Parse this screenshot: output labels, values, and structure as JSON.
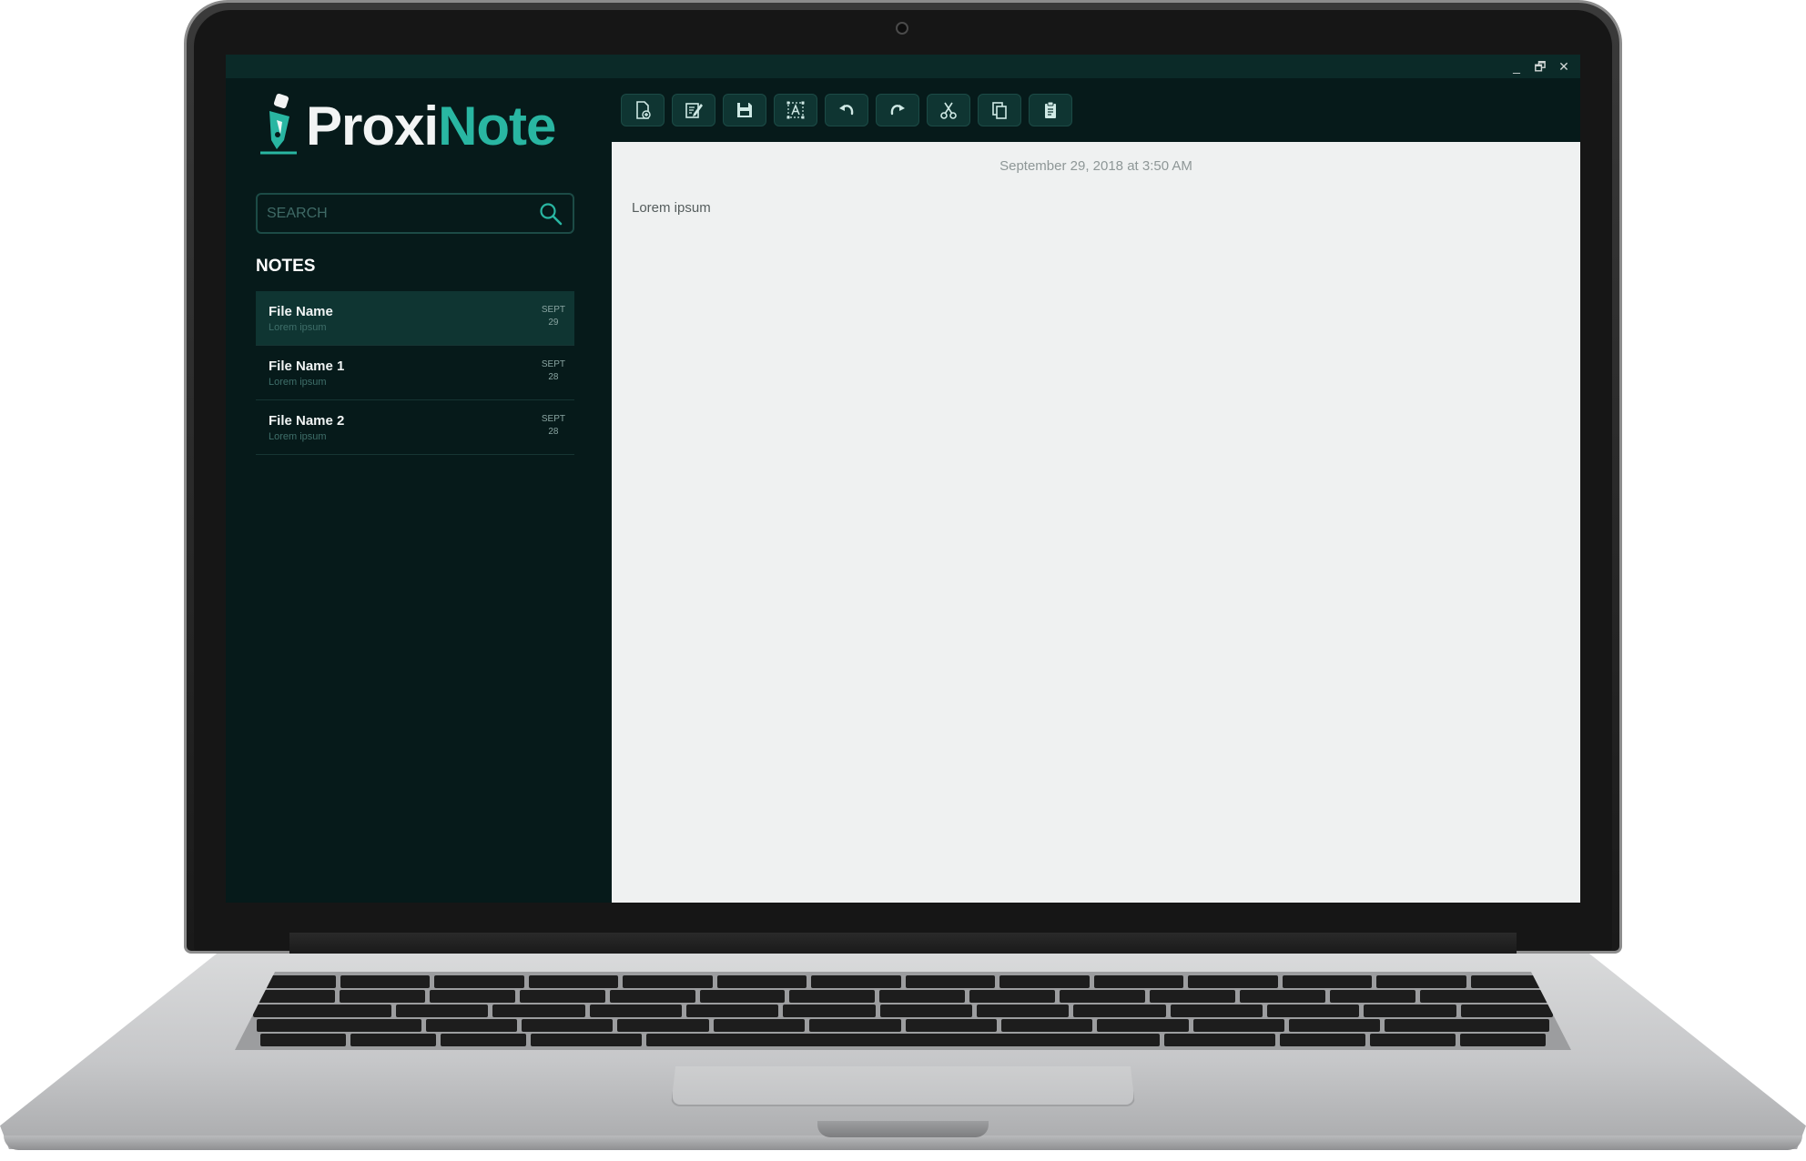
{
  "window": {
    "minimize_glyph": "_",
    "restore_glyph": "🗗",
    "close_glyph": "✕"
  },
  "app": {
    "name_part1": "Proxi",
    "name_part2": "Note"
  },
  "colors": {
    "accent": "#29b6a2",
    "sidebar_bg": "#061a1a",
    "selected_note_bg": "#0f3532",
    "editor_bg": "#eff1f1"
  },
  "search": {
    "placeholder": "SEARCH",
    "value": ""
  },
  "notes": {
    "heading": "NOTES",
    "items": [
      {
        "name": "File Name",
        "preview": "Lorem ipsum",
        "month": "SEPT",
        "day": "29",
        "selected": true
      },
      {
        "name": "File Name 1",
        "preview": "Lorem ipsum",
        "month": "SEPT",
        "day": "28",
        "selected": false
      },
      {
        "name": "File Name 2",
        "preview": "Lorem ipsum",
        "month": "SEPT",
        "day": "28",
        "selected": false
      }
    ]
  },
  "toolbar": {
    "icons": [
      "new-note-icon",
      "edit-icon",
      "save-icon",
      "text-format-icon",
      "undo-icon",
      "redo-icon",
      "cut-icon",
      "copy-icon",
      "paste-icon"
    ]
  },
  "editor": {
    "timestamp": "September 29, 2018 at 3:50 AM",
    "content": "Lorem ipsum"
  }
}
